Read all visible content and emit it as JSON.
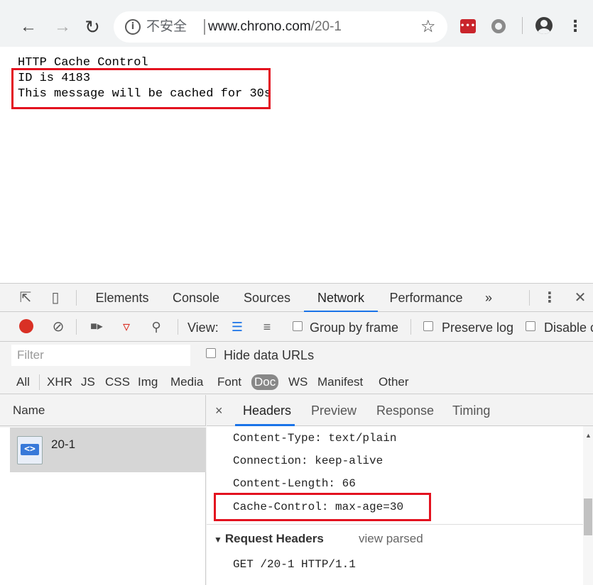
{
  "browser": {
    "back_icon": "arrow-left-icon",
    "forward_icon": "arrow-right-icon",
    "reload_icon": "reload-icon",
    "security_label": "不安全",
    "url_host": "www.chrono.com",
    "url_path": "/20-1",
    "bookmark_icon": "star-icon",
    "menu_icon": "vertical-dots-icon"
  },
  "page": {
    "line1": "HTTP Cache Control",
    "line2": "ID is 4183",
    "line3": "This message will be cached for 30s"
  },
  "devtools": {
    "tabs": [
      "Elements",
      "Console",
      "Sources",
      "Network",
      "Performance"
    ],
    "active_tab": "Network",
    "more_tabs": "»",
    "close": "✕",
    "toolbar": {
      "view_label": "View:",
      "group_by_frame": "Group by frame",
      "preserve_log": "Preserve log",
      "disable_cache": "Disable c"
    },
    "filter_placeholder": "Filter",
    "hide_data_urls": "Hide data URLs",
    "types": [
      "All",
      "XHR",
      "JS",
      "CSS",
      "Img",
      "Media",
      "Font",
      "Doc",
      "WS",
      "Manifest",
      "Other"
    ],
    "selected_type": "Doc",
    "name_header": "Name",
    "request_name": "20-1",
    "detail_tabs": [
      "Headers",
      "Preview",
      "Response",
      "Timing"
    ],
    "active_detail_tab": "Headers",
    "close_detail": "×",
    "response_headers": [
      "Content-Type: text/plain",
      "Connection: keep-alive",
      "Content-Length: 66",
      "Cache-Control: max-age=30"
    ],
    "request_section_title": "Request Headers",
    "view_parsed": "view parsed",
    "request_line": "GET /20-1 HTTP/1.1"
  },
  "colors": {
    "highlight": "#e3121f",
    "accent": "#1a73e8",
    "record": "#d93025"
  }
}
